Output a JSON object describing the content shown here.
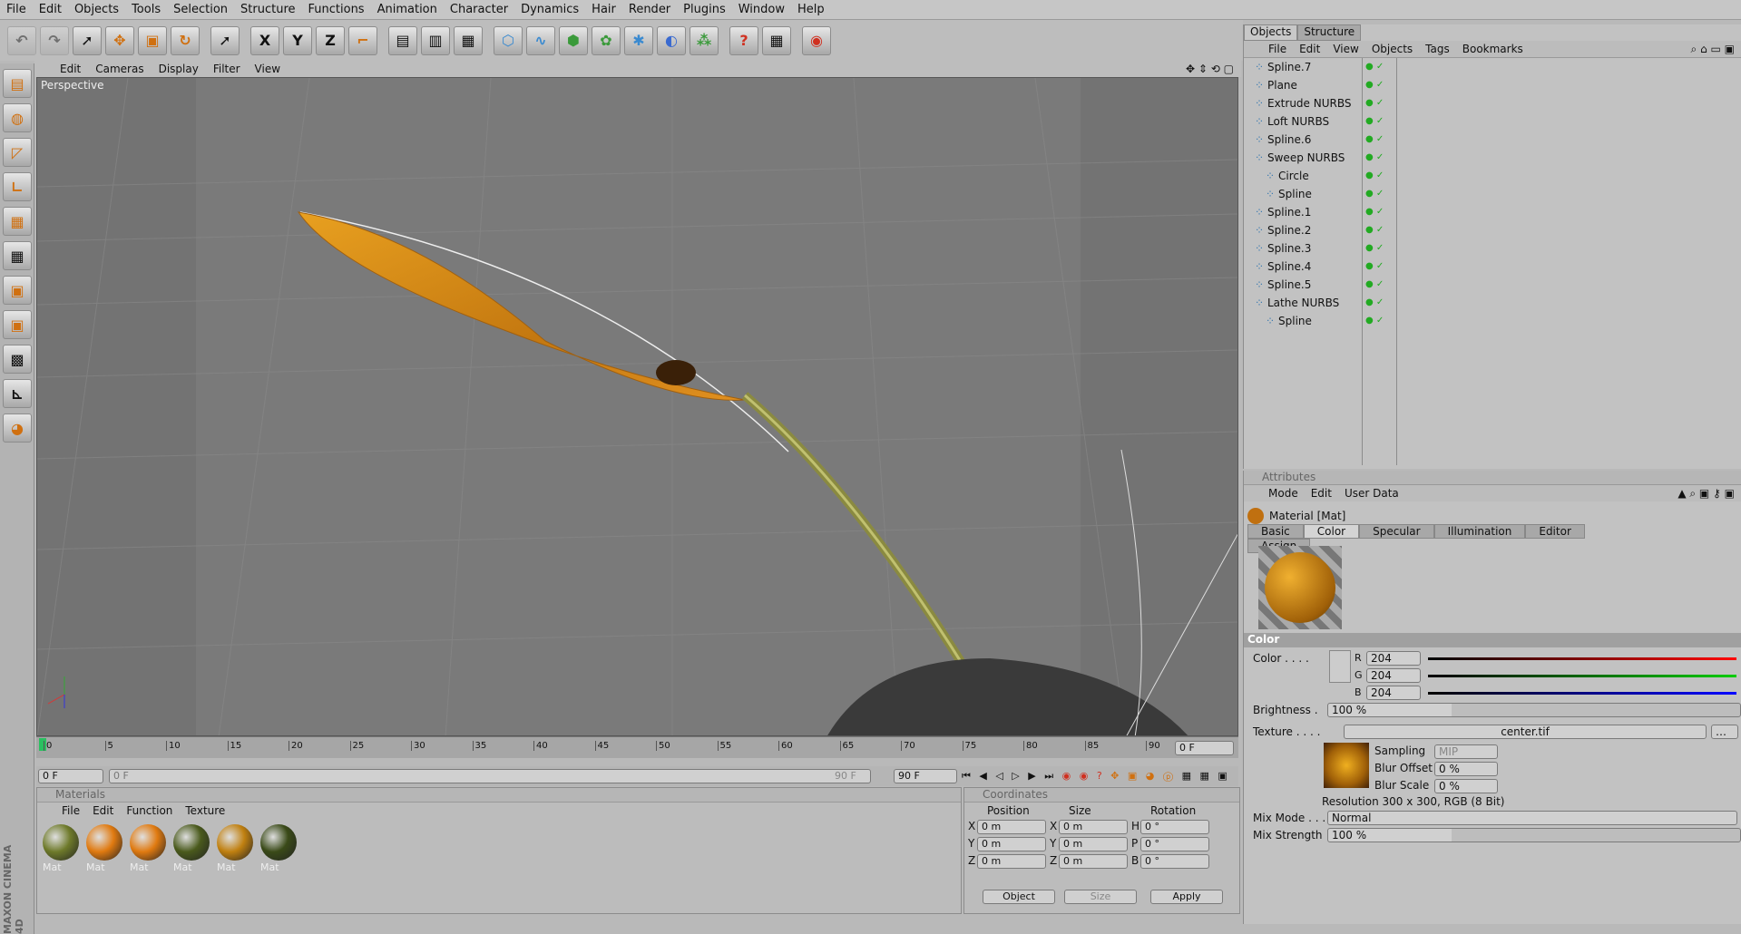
{
  "menu": [
    "File",
    "Edit",
    "Objects",
    "Tools",
    "Selection",
    "Structure",
    "Functions",
    "Animation",
    "Character",
    "Dynamics",
    "Hair",
    "Render",
    "Plugins",
    "Window",
    "Help"
  ],
  "toolbar": {
    "x": "X",
    "y": "Y",
    "z": "Z"
  },
  "viewport": {
    "menu": [
      "Edit",
      "Cameras",
      "Display",
      "Filter",
      "View"
    ],
    "label": "Perspective"
  },
  "timeline": {
    "ticks": [
      "0",
      "5",
      "10",
      "15",
      "20",
      "25",
      "30",
      "35",
      "40",
      "45",
      "50",
      "55",
      "60",
      "65",
      "70",
      "75",
      "80",
      "85",
      "90"
    ],
    "frame": "0 F",
    "start": "0 F",
    "start2": "0 F",
    "end1": "90 F",
    "end2": "90 F"
  },
  "materials": {
    "title": "Materials",
    "menu": [
      "File",
      "Edit",
      "Function",
      "Texture"
    ],
    "items": [
      {
        "label": "Mat",
        "color": "#6e7a2a"
      },
      {
        "label": "Mat",
        "color": "#e07a10"
      },
      {
        "label": "Mat",
        "color": "#e07a10"
      },
      {
        "label": "Mat",
        "color": "#4a5a1c"
      },
      {
        "label": "Mat",
        "color": "#c08010"
      },
      {
        "label": "Mat",
        "color": "#3a4a18"
      }
    ]
  },
  "coords": {
    "title": "Coordinates",
    "headers": [
      "Position",
      "Size",
      "Rotation"
    ],
    "rows": [
      {
        "a": "X",
        "av": "0 m",
        "b": "X",
        "bv": "0 m",
        "c": "H",
        "cv": "0 °"
      },
      {
        "a": "Y",
        "av": "0 m",
        "b": "Y",
        "bv": "0 m",
        "c": "P",
        "cv": "0 °"
      },
      {
        "a": "Z",
        "av": "0 m",
        "b": "Z",
        "bv": "0 m",
        "c": "B",
        "cv": "0 °"
      }
    ],
    "mode1": "Object",
    "mode2": "Size",
    "apply": "Apply"
  },
  "objects": {
    "tabs": [
      "Objects",
      "Structure"
    ],
    "menu": [
      "File",
      "Edit",
      "View",
      "Objects",
      "Tags",
      "Bookmarks"
    ],
    "items": [
      {
        "name": "Spline.7",
        "indent": 1
      },
      {
        "name": "Plane",
        "indent": 1
      },
      {
        "name": "Extrude NURBS",
        "indent": 1
      },
      {
        "name": "Loft NURBS",
        "indent": 1
      },
      {
        "name": "Spline.6",
        "indent": 1
      },
      {
        "name": "Sweep NURBS",
        "indent": 1
      },
      {
        "name": "Circle",
        "indent": 2
      },
      {
        "name": "Spline",
        "indent": 2
      },
      {
        "name": "Spline.1",
        "indent": 1
      },
      {
        "name": "Spline.2",
        "indent": 1
      },
      {
        "name": "Spline.3",
        "indent": 1
      },
      {
        "name": "Spline.4",
        "indent": 1
      },
      {
        "name": "Spline.5",
        "indent": 1
      },
      {
        "name": "Lathe NURBS",
        "indent": 1
      },
      {
        "name": "Spline",
        "indent": 2
      }
    ]
  },
  "attributes": {
    "title": "Attributes",
    "menu": [
      "Mode",
      "Edit",
      "User Data"
    ],
    "material": "Material [Mat]",
    "tabs": [
      "Basic",
      "Color",
      "Specular",
      "Illumination",
      "Editor",
      "Assign"
    ],
    "section": "Color",
    "color_label": "Color . . . .",
    "r": "204",
    "g": "204",
    "b": "204",
    "r_label": "R",
    "g_label": "G",
    "b_label": "B",
    "brightness_label": "Brightness .",
    "brightness": "100 %",
    "texture_label": "Texture . . . .",
    "texture": "center.tif",
    "sampling_label": "Sampling",
    "sampling": "MIP",
    "bluroffset_label": "Blur Offset",
    "bluroffset": "0 %",
    "blurscale_label": "Blur Scale",
    "blurscale": "0 %",
    "resolution": "Resolution 300 x 300, RGB (8 Bit)",
    "mixmode_label": "Mix Mode . . .",
    "mixmode": "Normal",
    "mixstrength_label": "Mix Strength",
    "mixstrength": "100 %"
  },
  "brand": "MAXON CINEMA 4D"
}
